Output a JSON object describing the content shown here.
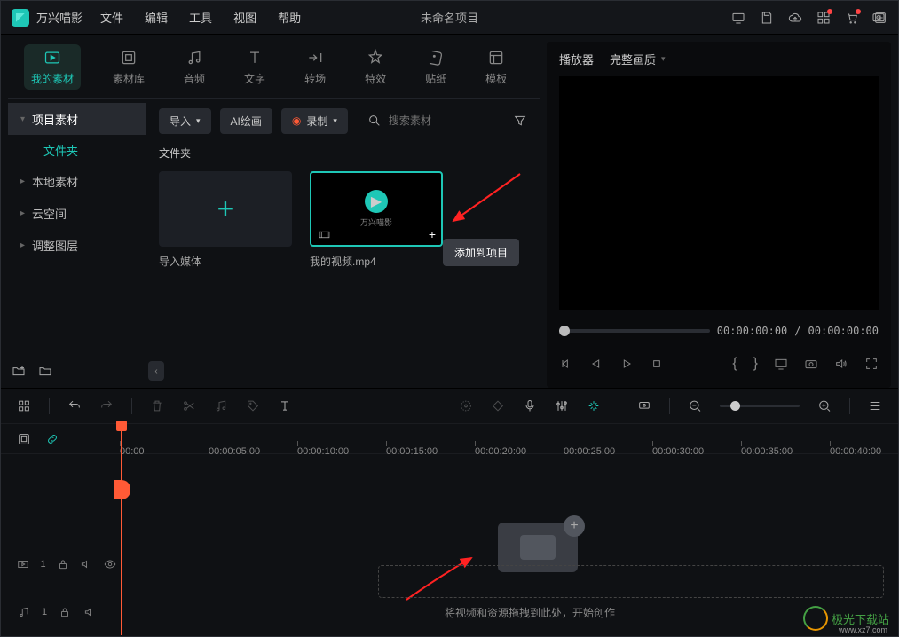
{
  "app": {
    "name": "万兴喵影"
  },
  "menu": {
    "file": "文件",
    "edit": "编辑",
    "tool": "工具",
    "view": "视图",
    "help": "帮助"
  },
  "project_title": "未命名项目",
  "tabs": {
    "my_media": "我的素材",
    "stock": "素材库",
    "audio": "音频",
    "text": "文字",
    "transition": "转场",
    "effect": "特效",
    "sticker": "贴纸",
    "template": "模板"
  },
  "sidebar": {
    "project": "项目素材",
    "folder": "文件夹",
    "local": "本地素材",
    "cloud": "云空间",
    "adjust": "调整图层"
  },
  "toolbar": {
    "import": "导入",
    "ai_paint": "AI绘画",
    "record": "录制",
    "search_placeholder": "搜索素材"
  },
  "section": {
    "folder_label": "文件夹"
  },
  "thumbs": {
    "import": "导入媒体",
    "video": "我的视频.mp4",
    "video_brand": "万兴喵影"
  },
  "tooltip": {
    "add_to_project": "添加到项目"
  },
  "preview": {
    "player": "播放器",
    "quality": "完整画质",
    "time_current": "00:00:00:00",
    "time_sep": "/",
    "time_total": "00:00:00:00",
    "braces_l": "{",
    "braces_r": "}"
  },
  "ruler": {
    "t0": "00:00",
    "t1": "00:00:05:00",
    "t2": "00:00:10:00",
    "t3": "00:00:15:00",
    "t4": "00:00:20:00",
    "t5": "00:00:25:00",
    "t6": "00:00:30:00",
    "t7": "00:00:35:00",
    "t8": "00:00:40:00"
  },
  "tracks": {
    "video_idx": "1",
    "audio_idx": "1"
  },
  "drop_hint": "将视频和资源拖拽到此处，开始创作",
  "watermark": {
    "text": "极光下载站",
    "url": "www.xz7.com"
  }
}
